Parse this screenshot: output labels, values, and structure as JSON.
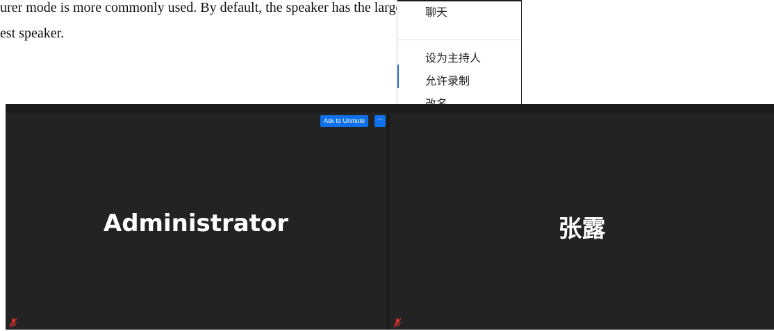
{
  "document": {
    "line1": "urer mode is more commonly used. By default, the speaker has the largest view, such as",
    "line2": "est speaker."
  },
  "context_menu": {
    "items": [
      {
        "label": "聊天"
      },
      {
        "label": "设为主持人"
      },
      {
        "label": "允许录制"
      },
      {
        "label": "改名"
      }
    ]
  },
  "meeting": {
    "tiles": [
      {
        "name": "Administrator",
        "ask_to_unmute_label": "Ask to Unmute",
        "more_label": "···",
        "mic_icon": "muted-mic-icon",
        "mic_color": "#d9332b"
      },
      {
        "name": "张露",
        "mic_icon": "muted-mic-icon",
        "mic_color": "#d9332b"
      }
    ],
    "colors": {
      "background": "#1b1b1b",
      "tile": "#232323",
      "button": "#0e71eb"
    }
  }
}
